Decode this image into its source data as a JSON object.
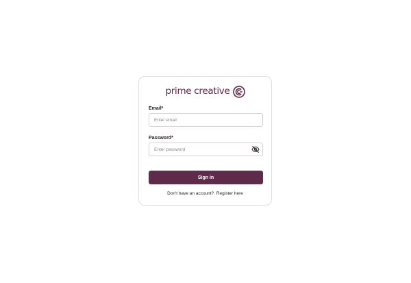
{
  "brand": {
    "name": "prime creative",
    "logo_icon": "pc-circle-logo-icon",
    "color": "#5b2747"
  },
  "form": {
    "email": {
      "label": "Email*",
      "placeholder": "Enter email",
      "value": ""
    },
    "password": {
      "label": "Password*",
      "placeholder": "Enter password",
      "value": "",
      "toggle_icon": "eye-off-icon"
    },
    "submit_label": "Sign in",
    "submit_color": "#5e2c4a"
  },
  "footer": {
    "prompt": "Don't have an account?",
    "link_label": "Register here"
  }
}
